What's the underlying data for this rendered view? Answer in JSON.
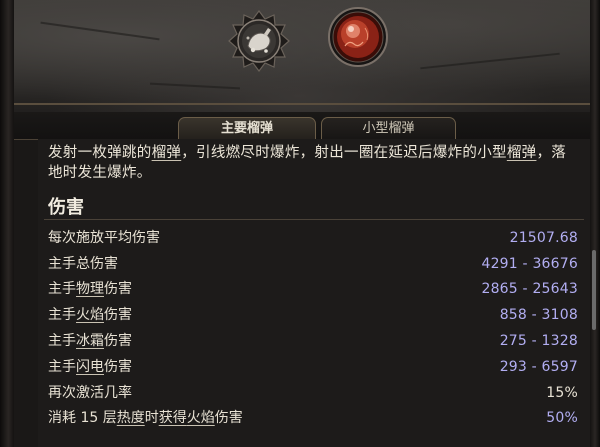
{
  "skill_icons": {
    "main": {
      "icon": "grenade-bounce-icon",
      "ring_color": "#2a2725"
    },
    "sub": {
      "icon": "fire-grenade-icon",
      "orb_color": "#9a2a1e"
    }
  },
  "tabs": [
    {
      "label": "主要榴弹",
      "active": true
    },
    {
      "label": "小型榴弹",
      "active": false
    }
  ],
  "description": {
    "parts": [
      "发射一枚弹跳的",
      "榴弹",
      "，引线燃尽时爆炸，射出一圈在延迟后爆炸的小型",
      "榴弹",
      "，落地时发生爆炸。"
    ]
  },
  "damage_section": {
    "title": "伤害",
    "rows": [
      {
        "label_parts": [
          "每次施放平均伤害"
        ],
        "value": "21507.68"
      },
      {
        "label_parts": [
          "主手总伤害"
        ],
        "value": "4291 - 36676"
      },
      {
        "label_parts": [
          "主手",
          "物理",
          "伤害"
        ],
        "value": "2865 - 25643"
      },
      {
        "label_parts": [
          "主手",
          "火焰",
          "伤害"
        ],
        "value": "858 - 3108"
      },
      {
        "label_parts": [
          "主手",
          "冰霜",
          "伤害"
        ],
        "value": "275 - 1328"
      },
      {
        "label_parts": [
          "主手",
          "闪电",
          "伤害"
        ],
        "value": "293 - 6597"
      },
      {
        "label_parts": [
          "再次激活几率"
        ],
        "value": "15%"
      },
      {
        "label_parts": [
          "消耗 15 层",
          "热度",
          "时",
          "获得",
          "火焰",
          "伤害"
        ],
        "value": "50%"
      }
    ]
  },
  "colors": {
    "value_accent": "#b2aef2",
    "text_primary": "#e8e2d4",
    "panel_bg": "#1d1b1a"
  }
}
